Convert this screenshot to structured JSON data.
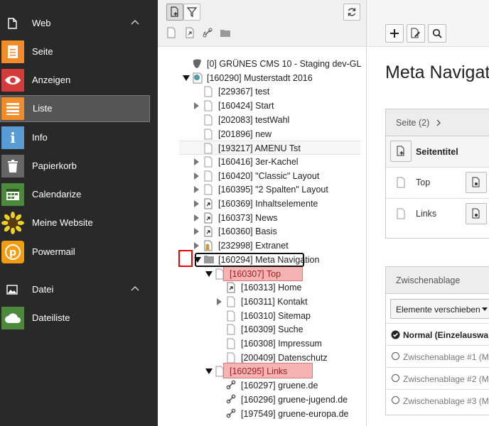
{
  "sidebar": {
    "groups": [
      {
        "label": "Web"
      },
      {
        "label": "Datei"
      }
    ],
    "web_modules": [
      {
        "label": "Seite",
        "color": "#f28c28"
      },
      {
        "label": "Anzeigen",
        "color": "#d43c3c"
      },
      {
        "label": "Liste",
        "color": "#f28c28"
      },
      {
        "label": "Info",
        "color": "#5b9bd5"
      },
      {
        "label": "Papierkorb",
        "color": "#666666"
      },
      {
        "label": "Calendarize",
        "color": "#4a8a3a"
      },
      {
        "label": "Meine Website",
        "color": "#f0d020"
      },
      {
        "label": "Powermail",
        "color": "#f39c12"
      }
    ],
    "file_modules": [
      {
        "label": "Dateiliste",
        "color": "#4a8a3a"
      }
    ],
    "active_module": "Liste"
  },
  "tree": {
    "nodes": [
      {
        "label": "[0] GRÜNES CMS 10 - Staging dev-GL"
      },
      {
        "label": "[160290] Musterstadt 2016"
      },
      {
        "label": "[229367] test"
      },
      {
        "label": "[160424] Start"
      },
      {
        "label": "[202083] testWahl"
      },
      {
        "label": "[201896] new"
      },
      {
        "label": "[193217] AMENU Tst"
      },
      {
        "label": "[160416] 3er-Kachel"
      },
      {
        "label": "[160420] \"Classic\" Layout"
      },
      {
        "label": "[160395] \"2 Spalten\" Layout"
      },
      {
        "label": "[160369] Inhaltselemente"
      },
      {
        "label": "[160373] News"
      },
      {
        "label": "[160360] Basis"
      },
      {
        "label": "[232998] Extranet"
      },
      {
        "label": "[160294] Meta Navigation"
      },
      {
        "label": "[160307] Top"
      },
      {
        "label": "[160313] Home"
      },
      {
        "label": "[160311] Kontakt"
      },
      {
        "label": "[160310] Sitemap"
      },
      {
        "label": "[160309] Suche"
      },
      {
        "label": "[160308] Impressum"
      },
      {
        "label": "[200409] Datenschutz"
      },
      {
        "label": "[160295] Links"
      },
      {
        "label": "[160297] gruene.de"
      },
      {
        "label": "[160296] gruene-jugend.de"
      },
      {
        "label": "[197549] gruene-europa.de"
      }
    ]
  },
  "content": {
    "title": "Meta Navigat",
    "page_panel": {
      "header": "Seite (2)",
      "column": "Seitentitel",
      "rows": [
        "Top",
        "Links"
      ]
    },
    "clipboard": {
      "header": "Zwischenablage",
      "select_value": "Elemente verschieben",
      "rows": [
        "Normal (Einzelauswa",
        "Zwischenablage #1 (Me",
        "Zwischenablage #2 (Me",
        "Zwischenablage #3 (Me"
      ]
    }
  }
}
